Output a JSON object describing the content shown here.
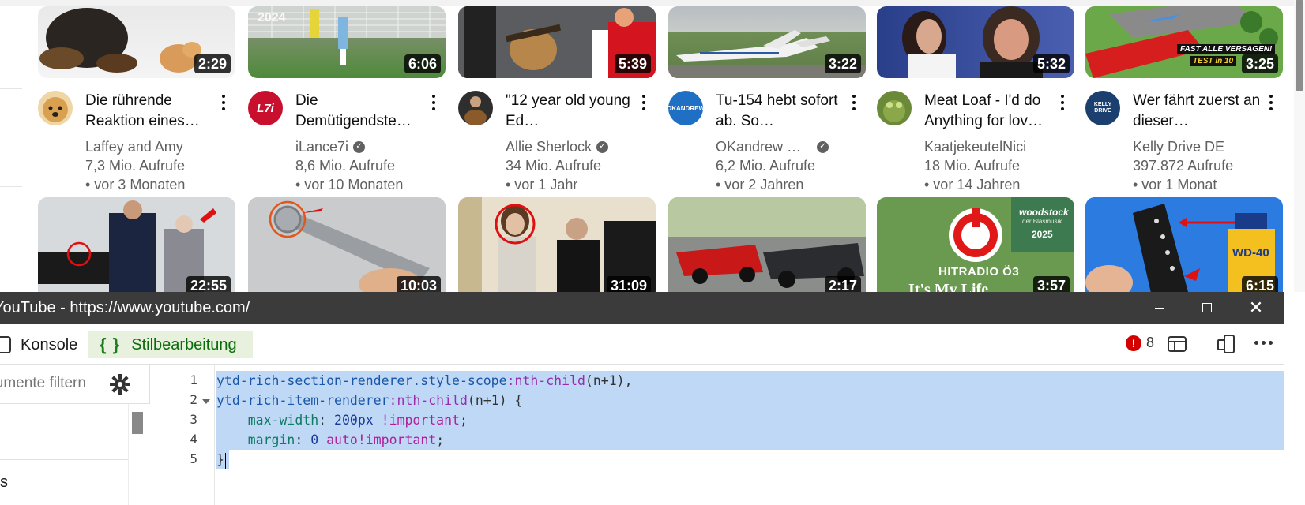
{
  "videos_row1": [
    {
      "title": "Die rührende Reaktion eines…",
      "channel": "Laffey and Amy",
      "verified": false,
      "views": "7,3 Mio. Aufrufe",
      "age": "• vor 3 Monaten",
      "duration": "2:29"
    },
    {
      "title": "Die Demütigendste…",
      "channel": "iLance7i",
      "verified": true,
      "views": "8,6 Mio. Aufrufe",
      "age": "• vor 10 Monaten",
      "duration": "6:06"
    },
    {
      "title": "\"12 year old young Ed…",
      "channel": "Allie Sherlock",
      "verified": true,
      "views": "34 Mio. Aufrufe",
      "age": "• vor 1 Jahr",
      "duration": "5:39"
    },
    {
      "title": "Tu-154 hebt sofort ab. So…",
      "channel": "OKandrew …",
      "verified": true,
      "views": "6,2 Mio. Aufrufe",
      "age": "• vor 2 Jahren",
      "duration": "3:22"
    },
    {
      "title": "Meat Loaf - I'd do Anything for lov…",
      "channel": "KaatjekeutelNici",
      "verified": false,
      "views": "18 Mio. Aufrufe",
      "age": "• vor 14 Jahren",
      "duration": "5:32"
    },
    {
      "title": "Wer fährt zuerst an dieser…",
      "channel": "Kelly Drive DE",
      "verified": false,
      "views": "397.872 Aufrufe",
      "age": "• vor 1 Monat",
      "duration": "3:25"
    }
  ],
  "videos_row2_durations": [
    "22:55",
    "10:03",
    "31:09",
    "2:17",
    "3:57",
    "6:15"
  ],
  "thumb_texts": {
    "thumb1_year": "2024",
    "thumb6_badge_line1": "FAST ALLE VERSAGEN!",
    "thumb6_badge_line2": "TEST in 10",
    "thumb11_logo": "HITRADIO Ö3",
    "thumb11_caption": "It's My Life",
    "thumb11_corner": "woodstock",
    "thumb11_corner_sub": "der Blasmusik",
    "thumb11_corner_year": "2025",
    "thumb12_can": "WD-40"
  },
  "avatar_texts": {
    "iLance7i": "L7i",
    "OKandrew": "OKANDREW",
    "KellyDrive": "KELLY DRIVE"
  },
  "devtools": {
    "window_title": "YouTube - https://www.youtube.com/",
    "tab_konsole": "Konsole",
    "tab_stil_braces": "{ }",
    "tab_stil": "Stilbearbeitung",
    "error_count": "8",
    "filter_placeholder": "Dokumente filtern",
    "left_item": "s",
    "line_numbers": [
      "1",
      "2",
      "3",
      "4",
      "5"
    ],
    "code": {
      "l1_sel": "ytd-rich-section-renderer.style-scope",
      "l1_pseudo": ":nth-child",
      "l1_args": "(n+1),",
      "l2_sel": "ytd-rich-item-renderer",
      "l2_pseudo": ":nth-child",
      "l2_args": "(n+1) {",
      "l3_prop": "max-width",
      "l3_colon": ":",
      "l3_val": "200px",
      "l3_imp": "!important",
      "l3_semi": ";",
      "l4_prop": "margin",
      "l4_colon": ":",
      "l4_val": "0",
      "l4_imp": "auto!important",
      "l4_semi": ";",
      "l5": "}"
    }
  },
  "colors": {
    "selection": "#bfd8f6",
    "titlebar": "#3b3b3b",
    "stil_tab_bg": "#e8f1de",
    "error_red": "#d40000"
  }
}
